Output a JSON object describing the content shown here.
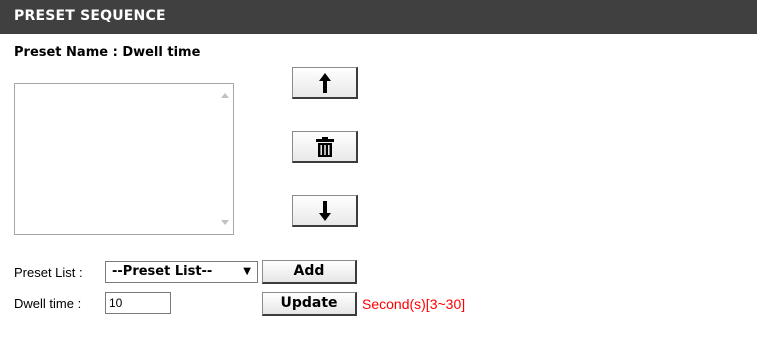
{
  "header": {
    "title": "PRESET SEQUENCE"
  },
  "preset": {
    "name_label": "Preset Name : Dwell time"
  },
  "form": {
    "preset_list_label": "Preset List :",
    "preset_list_selected": "--Preset List--",
    "dwell_label": "Dwell time :",
    "dwell_value": "10",
    "add_label": "Add",
    "update_label": "Update",
    "range_hint": "Second(s)[3~30]"
  },
  "colors": {
    "header_bg": "#404040",
    "hint": "#ff0000"
  },
  "icons": {
    "move_up": "arrow-up-icon",
    "delete": "trash-icon",
    "move_down": "arrow-down-icon",
    "select_caret": "caret-down-icon"
  }
}
